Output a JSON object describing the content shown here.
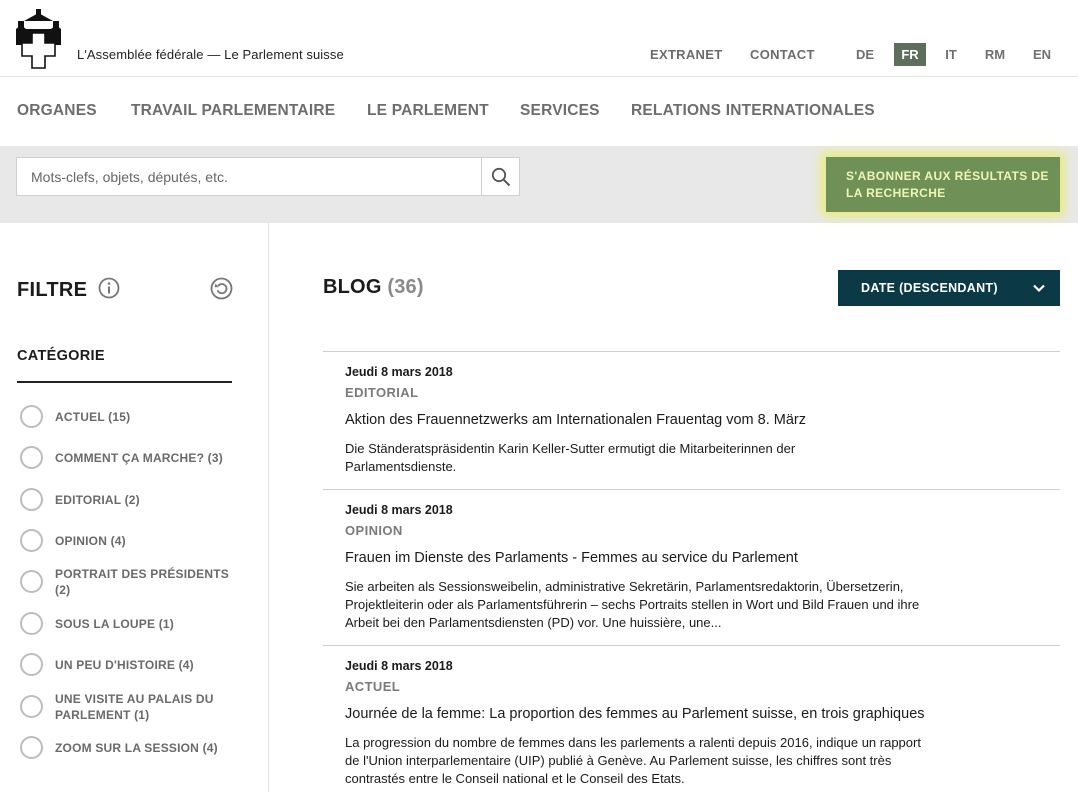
{
  "header": {
    "site_title": "L'Assemblée fédérale — Le Parlement suisse",
    "links": {
      "extranet": "EXTRANET",
      "contact": "CONTACT"
    },
    "languages": [
      "DE",
      "FR",
      "IT",
      "RM",
      "EN"
    ],
    "active_language": "FR"
  },
  "nav": {
    "items": [
      "ORGANES",
      "TRAVAIL PARLEMENTAIRE",
      "LE PARLEMENT",
      "SERVICES",
      "RELATIONS INTERNATIONALES"
    ]
  },
  "search": {
    "placeholder": "Mots-clefs, objets, députés, etc.",
    "value": "",
    "subscribe_label": "S'ABONNER AUX RÉSULTATS DE LA RECHERCHE"
  },
  "filter": {
    "title": "FILTRE",
    "category_title": "CATÉGORIE",
    "categories": [
      "ACTUEL (15)",
      "COMMENT ÇA MARCHE? (3)",
      "EDITORIAL (2)",
      "OPINION (4)",
      "PORTRAIT DES PRÉSIDENTS (2)",
      "SOUS LA LOUPE (1)",
      "UN PEU D'HISTOIRE (4)",
      "UNE VISITE AU PALAIS DU PARLEMENT (1)",
      "ZOOM SUR LA SESSION (4)"
    ]
  },
  "blog": {
    "title": "BLOG",
    "count": "(36)",
    "sort_label": "DATE (DESCENDANT)",
    "articles": [
      {
        "date": "Jeudi 8 mars 2018",
        "category": "EDITORIAL",
        "title": "Aktion des Frauennetzwerks am Internationalen Frauentag vom 8. März",
        "teaser": "Die Ständeratspräsidentin Karin Keller-Sutter ermutigt die Mitarbeiterinnen der Parlamentsdienste."
      },
      {
        "date": "Jeudi 8 mars 2018",
        "category": "OPINION",
        "title": "Frauen im Dienste des Parlaments - Femmes au service du Parlement",
        "teaser": "Sie arbeiten als Sessionsweibelin, administrative Sekretärin, Parlamentsredaktorin, Übersetzerin, Projektleiterin oder als Parlamentsführerin – sechs Portraits stellen in Wort und Bild Frauen und ihre Arbeit bei den Parlamentsdiensten (PD) vor. Une huissière, une..."
      },
      {
        "date": "Jeudi 8 mars 2018",
        "category": "ACTUEL",
        "title": "Journée de la femme: La proportion des femmes au Parlement suisse, en trois graphiques",
        "teaser": "La progression du nombre de femmes dans les parlements a ralenti depuis 2016, indique un rapport de l'Union interparlementaire (UIP) publié à Genève. Au Parlement suisse, les chiffres sont très contrastés entre le Conseil national et le Conseil des Etats."
      }
    ]
  },
  "colors": {
    "active_language_bg": "#5e6e5c",
    "subscribe_bg": "#6f9157",
    "sort_bg": "#0b3946",
    "nav_text": "#6d6d6d"
  },
  "icons": {
    "logo": "federal-palace-cross-logo",
    "search": "search-icon",
    "info": "info-icon",
    "reset": "reset-icon",
    "sort": "chevron-down-icon"
  }
}
